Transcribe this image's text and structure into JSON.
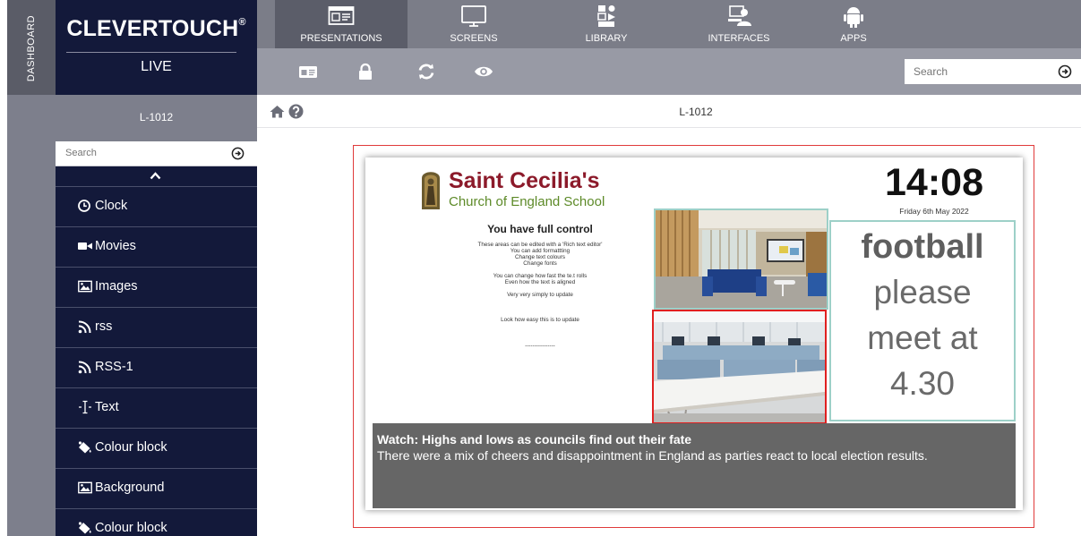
{
  "dashboard": {
    "label": "DASHBOARD"
  },
  "brand": {
    "name": "CLEVERTOUCH",
    "mark": "®",
    "sub": "LIVE"
  },
  "room": {
    "name": "L-1012"
  },
  "sidebar": {
    "search_placeholder": "Search",
    "items": [
      {
        "label": "Clock",
        "icon": "clock-icon"
      },
      {
        "label": "Movies",
        "icon": "video-camera-icon"
      },
      {
        "label": "Images",
        "icon": "image-icon"
      },
      {
        "label": "rss",
        "icon": "rss-icon"
      },
      {
        "label": "RSS-1",
        "icon": "rss-icon"
      },
      {
        "label": "Text",
        "icon": "text-cursor-icon"
      },
      {
        "label": "Colour block",
        "icon": "paint-bucket-icon"
      },
      {
        "label": "Background",
        "icon": "image-icon"
      },
      {
        "label": "Colour block",
        "icon": "paint-bucket-icon"
      }
    ]
  },
  "nav": {
    "tabs": [
      {
        "label": "PRESENTATIONS",
        "icon": "presentation-icon",
        "active": true
      },
      {
        "label": "SCREENS",
        "icon": "monitor-icon"
      },
      {
        "label": "LIBRARY",
        "icon": "media-library-icon"
      },
      {
        "label": "INTERFACES",
        "icon": "interface-icon"
      },
      {
        "label": "APPS",
        "icon": "android-icon"
      }
    ]
  },
  "toolbar": {
    "icons": [
      "card-icon",
      "lock-icon",
      "refresh-icon",
      "eye-icon"
    ],
    "search_placeholder": "Search"
  },
  "breadcrumb": {
    "title": "L-1012"
  },
  "slide": {
    "school_name": "Saint Cecilia's",
    "school_sub": "Church of England School",
    "control_title": "You have full control",
    "control_lines": [
      "These areas can be edited with a 'Rich text editor'",
      "You can add formattting",
      "Change text colours",
      "Change fonts",
      "",
      "You can change how fast the te.t rolls",
      "Even how the text is aligned",
      "",
      "Very very simply to update",
      "",
      "",
      "Look how easy this is to update",
      "",
      "",
      "",
      "----------------"
    ],
    "clock_time": "14:08",
    "clock_date": "Friday 6th May 2022",
    "message_lines": [
      "football",
      "please",
      "meet at",
      "4.30"
    ],
    "news_title": "Watch: Highs and lows as councils find out their fate",
    "news_body": "There were a mix of cheers and disappointment in England as parties react to local election results."
  },
  "colors": {
    "navy": "#13193a",
    "nav_gray": "#7b7d88",
    "active_tab": "#5b5d69",
    "frame_red": "#e03a3a",
    "school_red": "#8c1a2a",
    "school_green": "#5d8a28",
    "teal_border": "#9dd0c8"
  }
}
